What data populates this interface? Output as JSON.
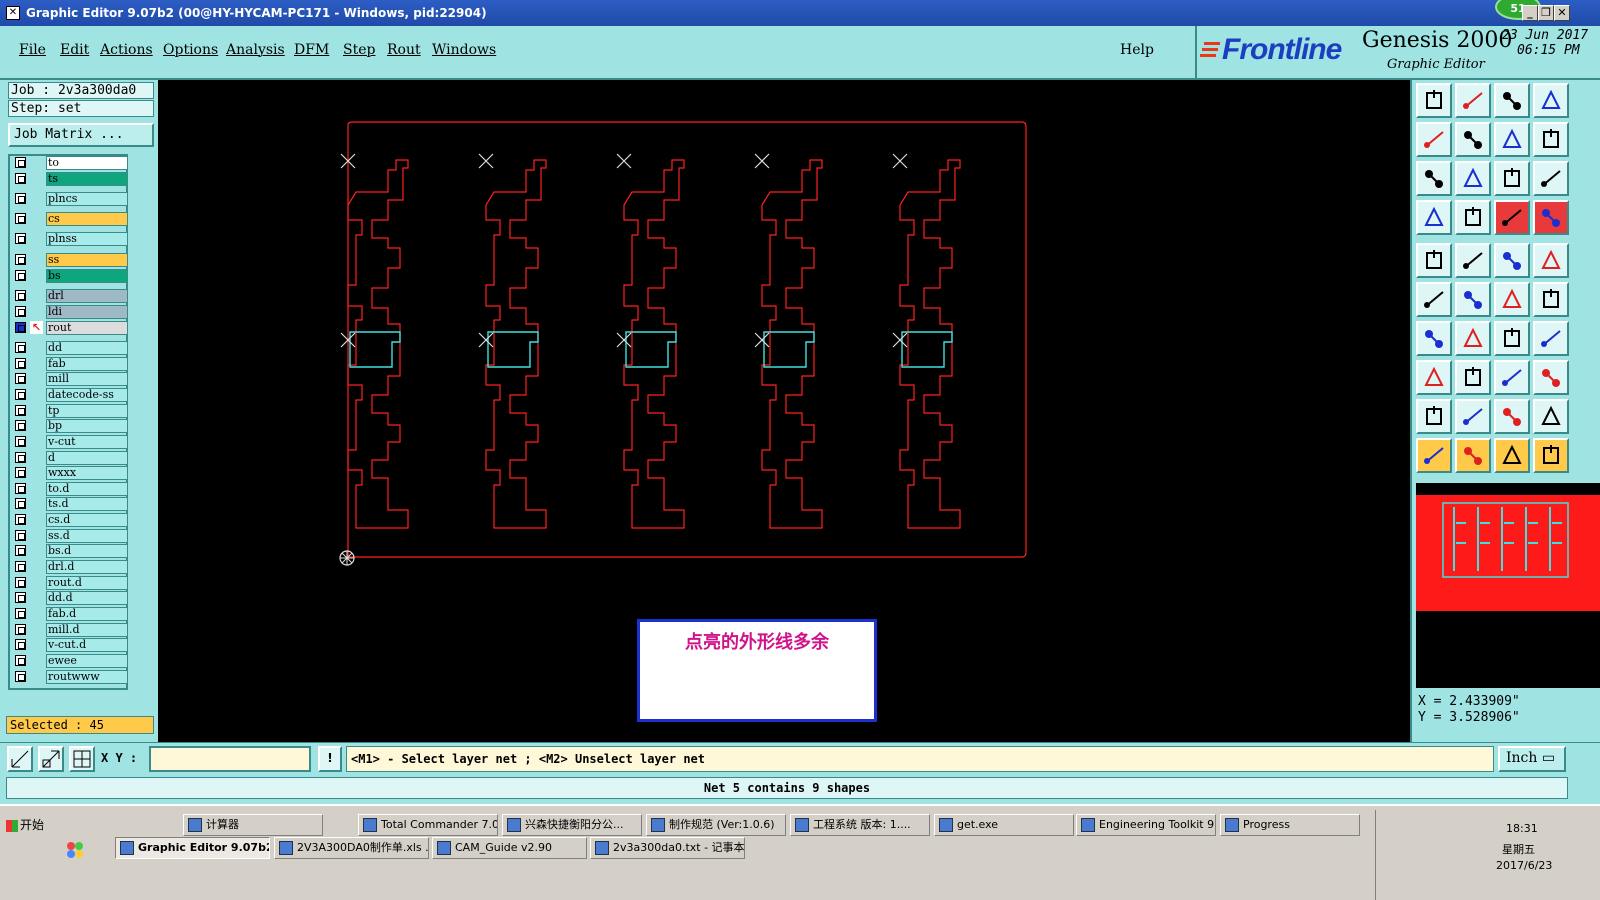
{
  "window": {
    "title": "Graphic Editor 9.07b2 (00@HY-HYCAM-PC171 - Windows, pid:22904)",
    "badge": "51",
    "minimize": "_",
    "restore": "❐",
    "close": "✕"
  },
  "menu": {
    "items": [
      "File",
      "Edit",
      "Actions",
      "Options",
      "Analysis",
      "DFM",
      "Step",
      "Rout",
      "Windows"
    ],
    "help": "Help"
  },
  "brand": {
    "logo": "Frontline",
    "product": "Genesis 2000",
    "subtitle": "Graphic Editor",
    "date": "23 Jun 2017",
    "time": "06:15 PM"
  },
  "job": {
    "job_line": "Job : 2v3a300da0",
    "step_line": "Step: set",
    "matrix_button": "Job Matrix ...",
    "selected": "Selected : 45"
  },
  "layers": [
    {
      "name": "to",
      "color": "#ffffff"
    },
    {
      "name": "ts",
      "color": "#0fa57d"
    },
    {
      "name": "plncs",
      "color": "#a6eaea"
    },
    {
      "name": "cs",
      "color": "#ffc94a"
    },
    {
      "name": "plnss",
      "color": "#a6eaea"
    },
    {
      "name": "ss",
      "color": "#ffc94a"
    },
    {
      "name": "bs",
      "color": "#0fa57d"
    },
    {
      "name": "drl",
      "color": "#9fb9c6"
    },
    {
      "name": "ldi",
      "color": "#9fb9c6"
    },
    {
      "name": "rout",
      "color": "#dcdcdc"
    },
    {
      "name": "dd",
      "color": "#a6eaea"
    },
    {
      "name": "fab",
      "color": "#a6eaea"
    },
    {
      "name": "mill",
      "color": "#a6eaea"
    },
    {
      "name": "datecode-ss",
      "color": "#a6eaea"
    },
    {
      "name": "tp",
      "color": "#a6eaea"
    },
    {
      "name": "bp",
      "color": "#a6eaea"
    },
    {
      "name": "v-cut",
      "color": "#a6eaea"
    },
    {
      "name": "d",
      "color": "#a6eaea"
    },
    {
      "name": "wxxx",
      "color": "#a6eaea"
    },
    {
      "name": "to.d",
      "color": "#a6eaea"
    },
    {
      "name": "ts.d",
      "color": "#a6eaea"
    },
    {
      "name": "cs.d",
      "color": "#a6eaea"
    },
    {
      "name": "ss.d",
      "color": "#a6eaea"
    },
    {
      "name": "bs.d",
      "color": "#a6eaea"
    },
    {
      "name": "drl.d",
      "color": "#a6eaea"
    },
    {
      "name": "rout.d",
      "color": "#a6eaea"
    },
    {
      "name": "dd.d",
      "color": "#a6eaea"
    },
    {
      "name": "fab.d",
      "color": "#a6eaea"
    },
    {
      "name": "mill.d",
      "color": "#a6eaea"
    },
    {
      "name": "v-cut.d",
      "color": "#a6eaea"
    },
    {
      "name": "ewee",
      "color": "#a6eaea"
    },
    {
      "name": "routwww",
      "color": "#a6eaea"
    }
  ],
  "canvas": {
    "note": "点亮的外形线多余",
    "outline_color": "#ff2020",
    "highlight_color": "#40e0e0"
  },
  "coords": {
    "x": "X = 2.433909\"",
    "y": "Y = 3.528906\""
  },
  "toolbar": {
    "xy_label": "X Y :",
    "xy_value": "",
    "bang": "!",
    "hint": "<M1> - Select layer net ; <M2> Unselect layer net",
    "units": "Inch ▭",
    "status": "Net 5 contains 9 shapes",
    "lower_icons": [
      "zoom-box-icon",
      "zoom-out-icon",
      "grid-icon"
    ]
  },
  "tools": [
    "home-icon",
    "print-icon",
    "house-icon",
    "window-icon",
    "left-icon",
    "right-icon",
    "arrows-icon",
    "flip-icon",
    "pan-icon",
    "fit-icon",
    "scale-icon",
    "help-icon",
    "settings-icon",
    "grid-icon",
    "layers-icon",
    "layers2-icon",
    "pad-icon",
    "shape-icon",
    "measure-icon",
    "dot-icon",
    "net-icon",
    "cross-icon",
    "line-icon",
    "diag-icon",
    "angle-icon",
    "slash-icon",
    "arc-icon",
    "split-icon",
    "node-icon",
    "minus-icon",
    "bridge-icon",
    "copy-icon",
    "text-icon",
    "text2-icon",
    "text3-icon",
    "text4-icon",
    "select-icon",
    "select2-icon",
    "select3-icon",
    "route-icon"
  ],
  "taskbar": {
    "start": "开始",
    "row1": [
      "计算器",
      "Total Commander 7.0...",
      "兴森快捷衡阳分公...",
      "制作规范 (Ver:1.0.6)",
      "工程系统  版本: 1....",
      "get.exe",
      "Engineering Toolkit 9....",
      "Progress"
    ],
    "row2": [
      "Graphic Editor 9.07b2 ...",
      "2V3A300DA0制作单.xls ...",
      "CAM_Guide v2.90",
      "2v3a300da0.txt - 记事本"
    ],
    "time": "18:31",
    "weekday": "星期五",
    "date": "2017/6/23"
  }
}
